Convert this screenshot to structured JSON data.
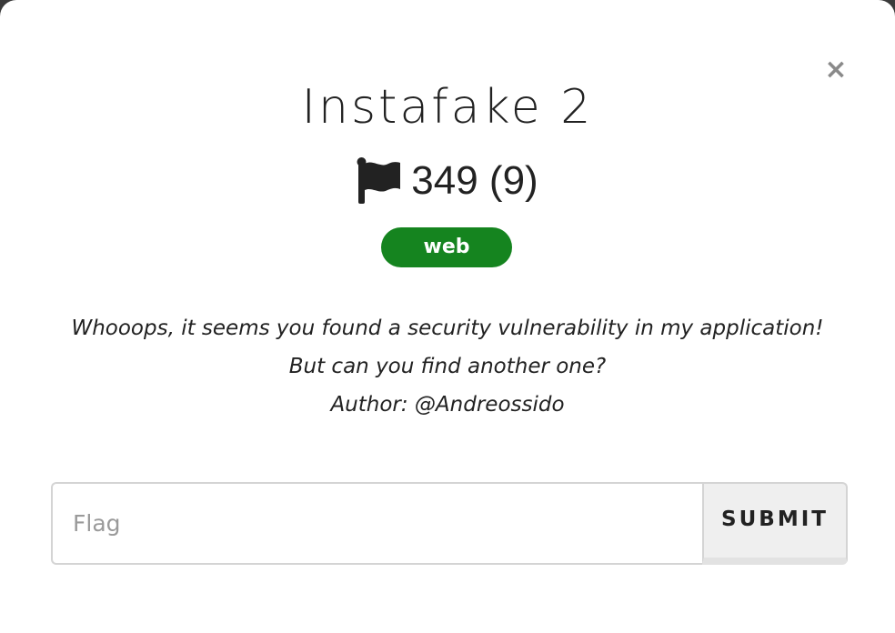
{
  "modal": {
    "close_label": "×",
    "title": "Instafake 2",
    "score": "349 (9)",
    "category_tag": "web",
    "description": {
      "line1": "Whooops, it seems you found a security vulnerability in my application!",
      "line2": "But can you find another one?",
      "line3": "Author: @Andreossido"
    },
    "form": {
      "flag_placeholder": "Flag",
      "flag_value": "",
      "submit_label": "SUBMIT"
    }
  },
  "icons": {
    "close": "close-icon",
    "flag": "flag-icon"
  },
  "colors": {
    "tag_background": "#15841f",
    "tag_text": "#ffffff",
    "text": "#222222",
    "close_icon": "#8a8a8a",
    "submit_background": "#efefef"
  }
}
